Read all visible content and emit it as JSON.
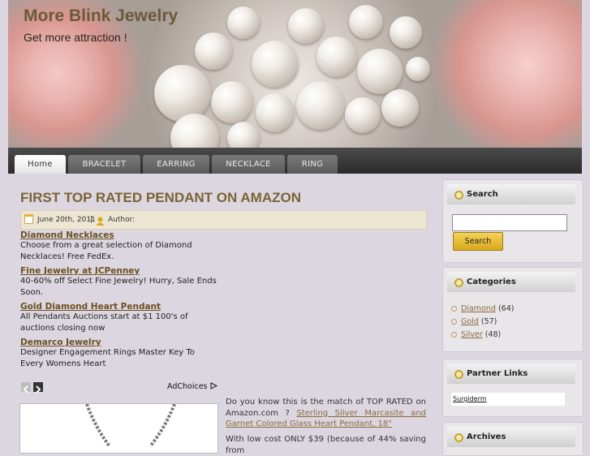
{
  "site": {
    "title": "More Blink Jewelry",
    "tagline": "Get more attraction !"
  },
  "nav": {
    "tabs": [
      "Home",
      "BRACELET",
      "EARRING",
      "NECKLACE",
      "RING"
    ],
    "active": "Home"
  },
  "post": {
    "title": "FIRST TOP RATED PENDANT ON AMAZON",
    "date": "June 20th, 2011",
    "separator": "|",
    "author_label": "Author:",
    "paragraph1": {
      "text": "Do you know this is the match of TOP RATED on Amazon.com  ?",
      "link": "Sterling Silver Marcasite and Garnet Colored Glass Heart Pendant, 18\""
    },
    "paragraph2": "With low cost ONLY $39 (because of 44% saving from"
  },
  "ads": {
    "items": [
      {
        "title": "Diamond Necklaces",
        "desc": "Choose from a great selection of Diamond Necklaces! Free FedEx."
      },
      {
        "title": "Fine Jewelry at JCPenney",
        "desc": "40-60% off Select Fine Jewelry! Hurry, Sale Ends Soon."
      },
      {
        "title": "Gold Diamond Heart Pendant",
        "desc": "All Pendants Auctions start at $1 100's of auctions closing now"
      },
      {
        "title": "Demarco Jewelry",
        "desc": "Designer Engagement Rings Master Key To Every Womens Heart"
      }
    ],
    "adchoices_label": "AdChoices"
  },
  "sidebar": {
    "search": {
      "heading": "Search",
      "button": "Search",
      "value": ""
    },
    "categories": {
      "heading": "Categories",
      "items": [
        {
          "name": "Diamond",
          "count": "(64)"
        },
        {
          "name": "Gold",
          "count": "(57)"
        },
        {
          "name": "Silver",
          "count": "(48)"
        }
      ]
    },
    "partner_links": {
      "heading": "Partner Links",
      "items": [
        "Surgiderm"
      ]
    },
    "archives": {
      "heading": "Archives"
    }
  },
  "colors": {
    "accent": "#7a6434",
    "link": "#8a6a3a",
    "button": "#e8bf32",
    "nav_bg": "#333333"
  }
}
